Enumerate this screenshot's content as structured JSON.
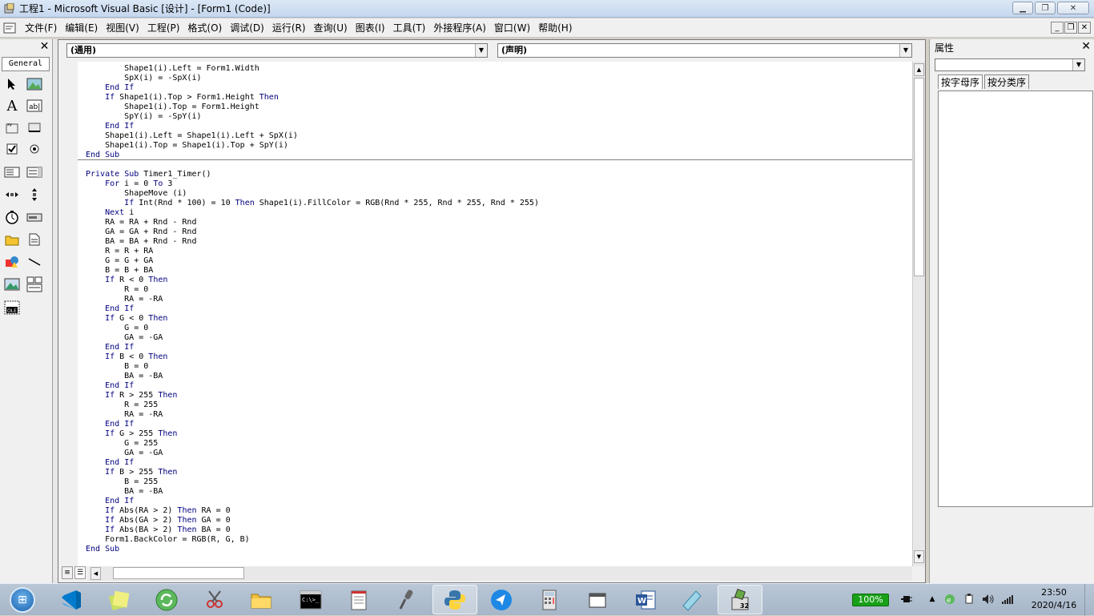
{
  "window": {
    "title": "工程1 - Microsoft Visual Basic [设计] - [Form1 (Code)]"
  },
  "menu": [
    "文件(F)",
    "编辑(E)",
    "视图(V)",
    "工程(P)",
    "格式(O)",
    "调试(D)",
    "运行(R)",
    "查询(U)",
    "图表(I)",
    "工具(T)",
    "外接程序(A)",
    "窗口(W)",
    "帮助(H)"
  ],
  "toolbox": {
    "tab": "General"
  },
  "code_window": {
    "object_combo": "(通用)",
    "proc_combo": "(声明)",
    "lines": [
      "        Shape1(i).Left = Form1.Width",
      "        SpX(i) = -SpX(i)",
      "    End If",
      "    If Shape1(i).Top > Form1.Height Then",
      "        Shape1(i).Top = Form1.Height",
      "        SpY(i) = -SpY(i)",
      "    End If",
      "    Shape1(i).Left = Shape1(i).Left + SpX(i)",
      "    Shape1(i).Top = Shape1(i).Top + SpY(i)",
      "End Sub",
      "",
      "Private Sub Timer1_Timer()",
      "    For i = 0 To 3",
      "        ShapeMove (i)",
      "        If Int(Rnd * 100) = 10 Then Shape1(i).FillColor = RGB(Rnd * 255, Rnd * 255, Rnd * 255)",
      "    Next i",
      "    RA = RA + Rnd - Rnd",
      "    GA = GA + Rnd - Rnd",
      "    BA = BA + Rnd - Rnd",
      "    R = R + RA",
      "    G = G + GA",
      "    B = B + BA",
      "    If R < 0 Then",
      "        R = 0",
      "        RA = -RA",
      "    End If",
      "    If G < 0 Then",
      "        G = 0",
      "        GA = -GA",
      "    End If",
      "    If B < 0 Then",
      "        B = 0",
      "        BA = -BA",
      "    End If",
      "    If R > 255 Then",
      "        R = 255",
      "        RA = -RA",
      "    End If",
      "    If G > 255 Then",
      "        G = 255",
      "        GA = -GA",
      "    End If",
      "    If B > 255 Then",
      "        B = 255",
      "        BA = -BA",
      "    End If",
      "    If Abs(RA > 2) Then RA = 0",
      "    If Abs(GA > 2) Then GA = 0",
      "    If Abs(BA > 2) Then BA = 0",
      "    Form1.BackColor = RGB(R, G, B)",
      "End Sub"
    ]
  },
  "properties": {
    "title": "属性",
    "tabs": [
      "按字母序",
      "按分类序"
    ]
  },
  "taskbar": {
    "battery": "100%",
    "time": "23:50",
    "date": "2020/4/16"
  },
  "colors": {
    "keyword": "#00007f",
    "code_text": "#000000"
  }
}
